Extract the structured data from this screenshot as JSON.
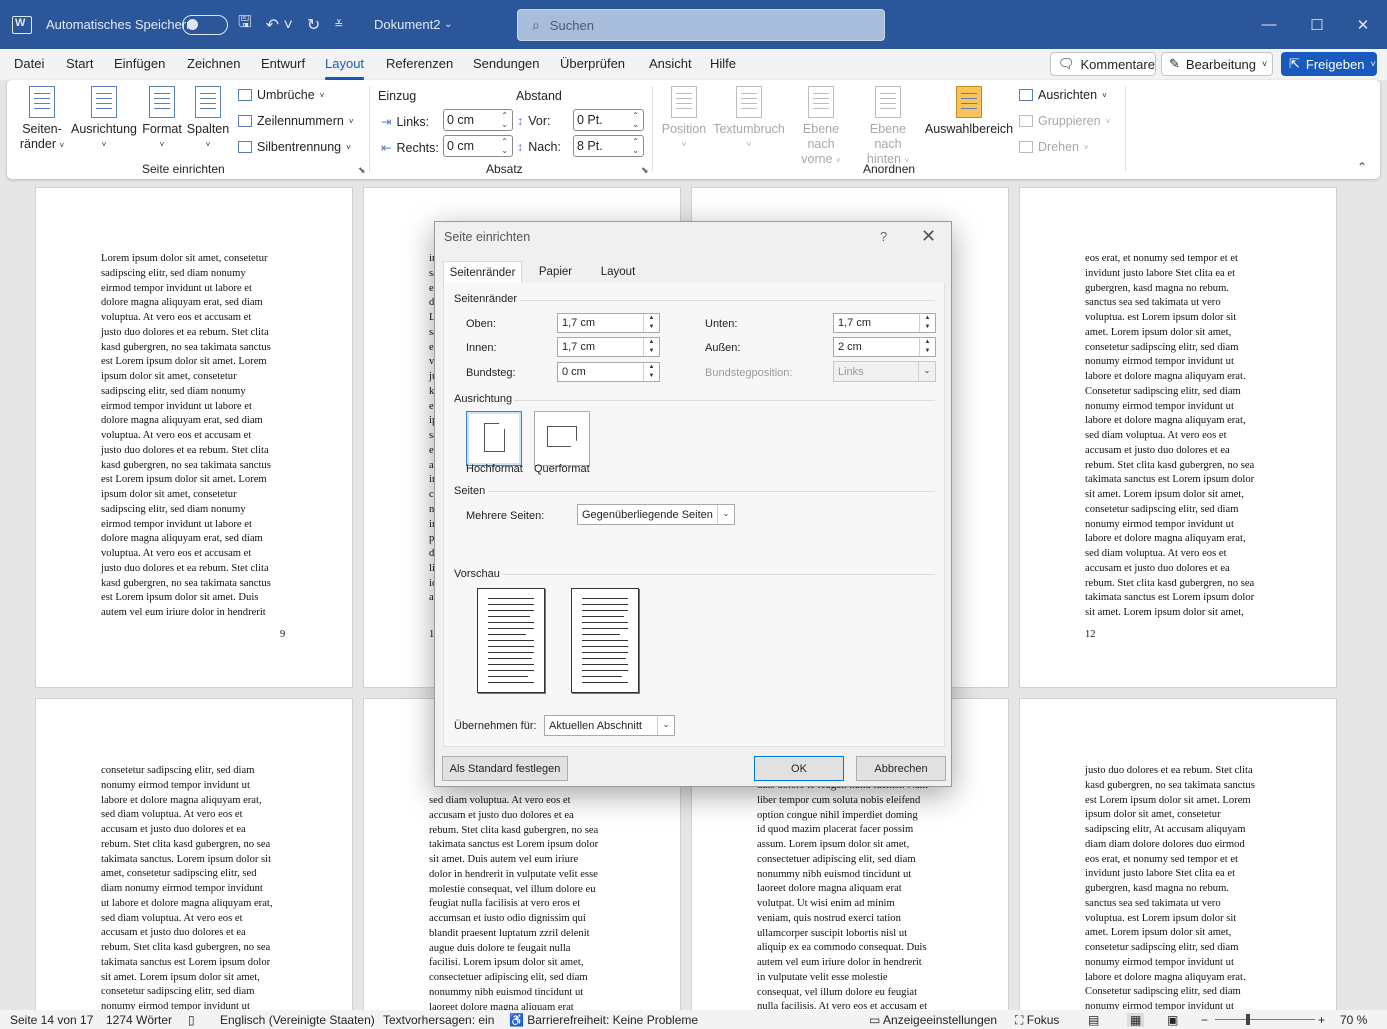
{
  "titlebar": {
    "autosave_label": "Automatisches Speichern",
    "doc_name": "Dokument2",
    "search_placeholder": "Suchen",
    "min_icon": "minimize-icon",
    "max_icon": "maximize-icon",
    "close_icon": "close-icon"
  },
  "menu": {
    "items": [
      "Datei",
      "Start",
      "Einfügen",
      "Zeichnen",
      "Entwurf",
      "Layout",
      "Referenzen",
      "Sendungen",
      "Überprüfen",
      "Ansicht",
      "Hilfe"
    ],
    "active": "Layout",
    "comments": "Kommentare",
    "editing": "Bearbeitung",
    "share": "Freigeben"
  },
  "ribbon": {
    "seite": {
      "margins_l1": "Seiten-",
      "margins_l2": "ränder",
      "orientation": "Ausrichtung",
      "format": "Format",
      "columns": "Spalten",
      "breaks": "Umbrüche",
      "line_numbers": "Zeilennummern",
      "hyphenation": "Silbentrennung",
      "group": "Seite einrichten"
    },
    "absatz": {
      "indent": "Einzug",
      "spacing": "Abstand",
      "left": "Links:",
      "right": "Rechts:",
      "before": "Vor:",
      "after": "Nach:",
      "left_val": "0 cm",
      "right_val": "0 cm",
      "before_val": "0 Pt.",
      "after_val": "8 Pt.",
      "group": "Absatz"
    },
    "anordnen": {
      "position": "Position",
      "wrap": "Textumbruch",
      "forward_l1": "Ebene nach",
      "forward_l2": "vorne",
      "backward_l1": "Ebene nach",
      "backward_l2": "hinten",
      "selection": "Auswahlbereich",
      "align": "Ausrichten",
      "group_objs": "Gruppieren",
      "rotate": "Drehen",
      "group": "Anordnen"
    }
  },
  "pages": {
    "p9": {
      "text": "Lorem ipsum dolor sit amet, consetetur\nsadipscing elitr, sed diam nonumy\neirmod tempor invidunt ut labore et\ndolore magna aliquyam erat, sed diam\nvoluptua. At vero eos et accusam et\njusto duo dolores et ea rebum. Stet clita\nkasd gubergren, no sea takimata sanctus\nest Lorem ipsum dolor sit amet. Lorem\nipsum dolor sit amet, consetetur\nsadipscing elitr, sed diam nonumy\neirmod tempor invidunt ut labore et\ndolore magna aliquyam erat, sed diam\nvoluptua. At vero eos et accusam et\njusto duo dolores et ea rebum. Stet clita\nkasd gubergren, no sea takimata sanctus\nest Lorem ipsum dolor sit amet. Lorem\nipsum dolor sit amet, consetetur\nsadipscing elitr, sed diam nonumy\neirmod tempor invidunt ut labore et\ndolore magna aliquyam erat, sed diam\nvoluptua. At vero eos et accusam et\njusto duo dolores et ea rebum. Stet clita\nkasd gubergren, no sea takimata sanctus\nest Lorem ipsum dolor sit amet. Duis\nautem vel eum iriure dolor in hendrerit",
      "num": "9"
    },
    "p10": {
      "text": "in\nsa\nei\ndo\nLo\nsa\nei\nvo\nju\nka\nes\nip\nsa\nei\nat\nin\nco\nni\nin\np\nd\nli\nid\nap",
      "num": "1"
    },
    "p12": {
      "text": "eos erat, et nonumy sed tempor et et\ninvidunt justo labore Stet clita ea et\ngubergren, kasd magna no rebum.\nsanctus sea sed takimata ut vero\nvoluptua. est Lorem ipsum dolor sit\namet. Lorem ipsum dolor sit amet,\nconsetetur sadipscing elitr, sed diam\nnonumy eirmod tempor invidunt ut\nlabore et dolore magna aliquyam erat.\nConsetetur sadipscing elitr, sed diam\nnonumy eirmod tempor invidunt ut\nlabore et dolore magna aliquyam erat,\nsed diam voluptua. At vero eos et\naccusam et justo duo dolores et ea\nrebum. Stet clita kasd gubergren, no sea\ntakimata sanctus est Lorem ipsum dolor\nsit amet. Lorem ipsum dolor sit amet,\nconsetetur sadipscing elitr, sed diam\nnonumy eirmod tempor invidunt ut\nlabore et dolore magna aliquyam erat,\nsed diam voluptua. At vero eos et\naccusam et justo duo dolores et ea\nrebum. Stet clita kasd gubergren, no sea\ntakimata sanctus est Lorem ipsum dolor\nsit amet. Lorem ipsum dolor sit amet,",
      "num": "12"
    },
    "p13": {
      "text": "consetetur sadipscing elitr, sed diam\nnonumy eirmod tempor invidunt ut\nlabore et dolore magna aliquyam erat,\nsed diam voluptua. At vero eos et\naccusam et justo duo dolores et ea\nrebum. Stet clita kasd gubergren, no sea\ntakimata sanctus. Lorem ipsum dolor sit\namet, consetetur sadipscing elitr, sed\ndiam nonumy eirmod tempor invidunt\nut labore et dolore magna aliquyam erat,\nsed diam voluptua. At vero eos et\naccusam et justo duo dolores et ea\nrebum. Stet clita kasd gubergren, no sea\ntakimata sanctus est Lorem ipsum dolor\nsit amet. Lorem ipsum dolor sit amet,\nconsetetur sadipscing elitr, sed diam\nnonumy eirmod tempor invidunt ut"
    },
    "p14": {
      "text": "sed diam voluptua. At vero eos et\naccusam et justo duo dolores et ea\nrebum. Stet clita kasd gubergren, no sea\ntakimata sanctus est Lorem ipsum dolor\nsit amet. Duis autem vel eum iriure\ndolor in hendrerit in vulputate velit esse\nmolestie consequat, vel illum dolore eu\nfeugiat nulla facilisis at vero eros et\naccumsan et iusto odio dignissim qui\nblandit praesent luptatum zzril delenit\naugue duis dolore te feugait nulla\nfacilisi. Lorem ipsum dolor sit amet,\nconsectetuer adipiscing elit, sed diam\nnonummy nibh euismod tincidunt ut\nlaoreet dolore magna aliquam erat\nvolutpat. Ut wisi enim ad minim"
    },
    "p15": {
      "text": "duis dolore te feugait nulla facilisi. Nam\nliber tempor cum soluta nobis eleifend\noption congue nihil imperdiet doming\nid quod mazim placerat facer possim\nassum. Lorem ipsum dolor sit amet,\nconsectetuer adipiscing elit, sed diam\nnonummy nibh euismod tincidunt ut\nlaoreet dolore magna aliquam erat\nvolutpat. Ut wisi enim ad minim\nveniam, quis nostrud exerci tation\nullamcorper suscipit lobortis nisl ut\naliquip ex ea commodo consequat. Duis\nautem vel eum iriure dolor in hendrerit\nin vulputate velit esse molestie\nconsequat, vel illum dolore eu feugiat\nnulla facilisis. At vero eos et accusam et"
    },
    "p16": {
      "text": "justo duo dolores et ea rebum. Stet clita\nkasd gubergren, no sea takimata sanctus\nest Lorem ipsum dolor sit amet. Lorem\nipsum dolor sit amet, consetetur\nsadipscing elitr, At accusam aliquyam\ndiam diam dolore dolores duo eirmod\neos erat, et nonumy sed tempor et et\ninvidunt justo labore Stet clita ea et\ngubergren, kasd magna no rebum.\nsanctus sea sed takimata ut vero\nvoluptua. est Lorem ipsum dolor sit\namet. Lorem ipsum dolor sit amet,\nconsetetur sadipscing elitr, sed diam\nnonumy eirmod tempor invidunt ut\nlabore et dolore magna aliquyam erat.\nConsetetur sadipscing elitr, sed diam\nnonumy eirmod tempor invidunt ut"
    }
  },
  "dialog": {
    "title": "Seite einrichten",
    "help": "?",
    "tabs": [
      "Seitenränder",
      "Papier",
      "Layout"
    ],
    "sec_margins": "Seitenränder",
    "top_label": "Oben:",
    "top_val": "1,7 cm",
    "inner_label": "Innen:",
    "inner_val": "1,7 cm",
    "gutter_label": "Bundsteg:",
    "gutter_val": "0 cm",
    "bottom_label": "Unten:",
    "bottom_val": "1,7 cm",
    "outer_label": "Außen:",
    "outer_val": "2 cm",
    "gutter_pos_label": "Bundstegposition:",
    "gutter_pos_val": "Links",
    "sec_orientation": "Ausrichtung",
    "portrait": "Hochformat",
    "landscape": "Querformat",
    "sec_pages": "Seiten",
    "multiple_label": "Mehrere Seiten:",
    "multiple_val": "Gegenüberliegende Seiten",
    "sec_preview": "Vorschau",
    "apply_label": "Übernehmen für:",
    "apply_val": "Aktuellen Abschnitt",
    "default_btn": "Als Standard festlegen",
    "ok": "OK",
    "cancel": "Abbrechen"
  },
  "status": {
    "page": "Seite 14 von 17",
    "words": "1274 Wörter",
    "lang": "Englisch (Vereinigte Staaten)",
    "predict": "Textvorhersagen: ein",
    "access": "Barrierefreiheit: Keine Probleme",
    "display": "Anzeigeeinstellungen",
    "focus": "Fokus",
    "zoom": "70 %"
  }
}
